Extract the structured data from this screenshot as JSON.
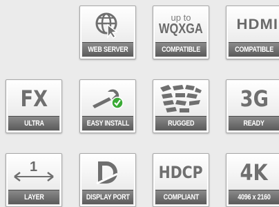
{
  "badges": [
    {
      "id": "web-server",
      "label": "WEB SERVER",
      "icon": "globe-cursor-icon"
    },
    {
      "id": "wqxga",
      "label": "COMPATIBLE",
      "top_line1": "up to",
      "top_line2": "WQXGA"
    },
    {
      "id": "hdmi",
      "label": "COMPATIBLE",
      "top_line1": "HDMI"
    },
    {
      "id": "fx",
      "label": "ULTRA",
      "top_line1": "FX"
    },
    {
      "id": "easy-install",
      "label": "EASY INSTALL",
      "icon": "wrench-check-icon"
    },
    {
      "id": "rugged",
      "label": "RUGGED",
      "icon": "tire-tread-icon"
    },
    {
      "id": "3g",
      "label": "READY",
      "top_line1": "3G"
    },
    {
      "id": "layer",
      "label": "LAYER",
      "top_line1": "1",
      "icon": "layer-arrows-icon"
    },
    {
      "id": "display-port",
      "label": "DISPLAY PORT",
      "icon": "displayport-logo-icon"
    },
    {
      "id": "hdcp",
      "label": "COMPLIANT",
      "top_line1": "HDCP"
    },
    {
      "id": "4k",
      "label": "4096 x 2160",
      "top_line1": "4K"
    }
  ],
  "colors": {
    "icon_gray": "#6f6f6f",
    "strip_gray": "#6a6a6a",
    "check_green": "#3aaa35"
  }
}
